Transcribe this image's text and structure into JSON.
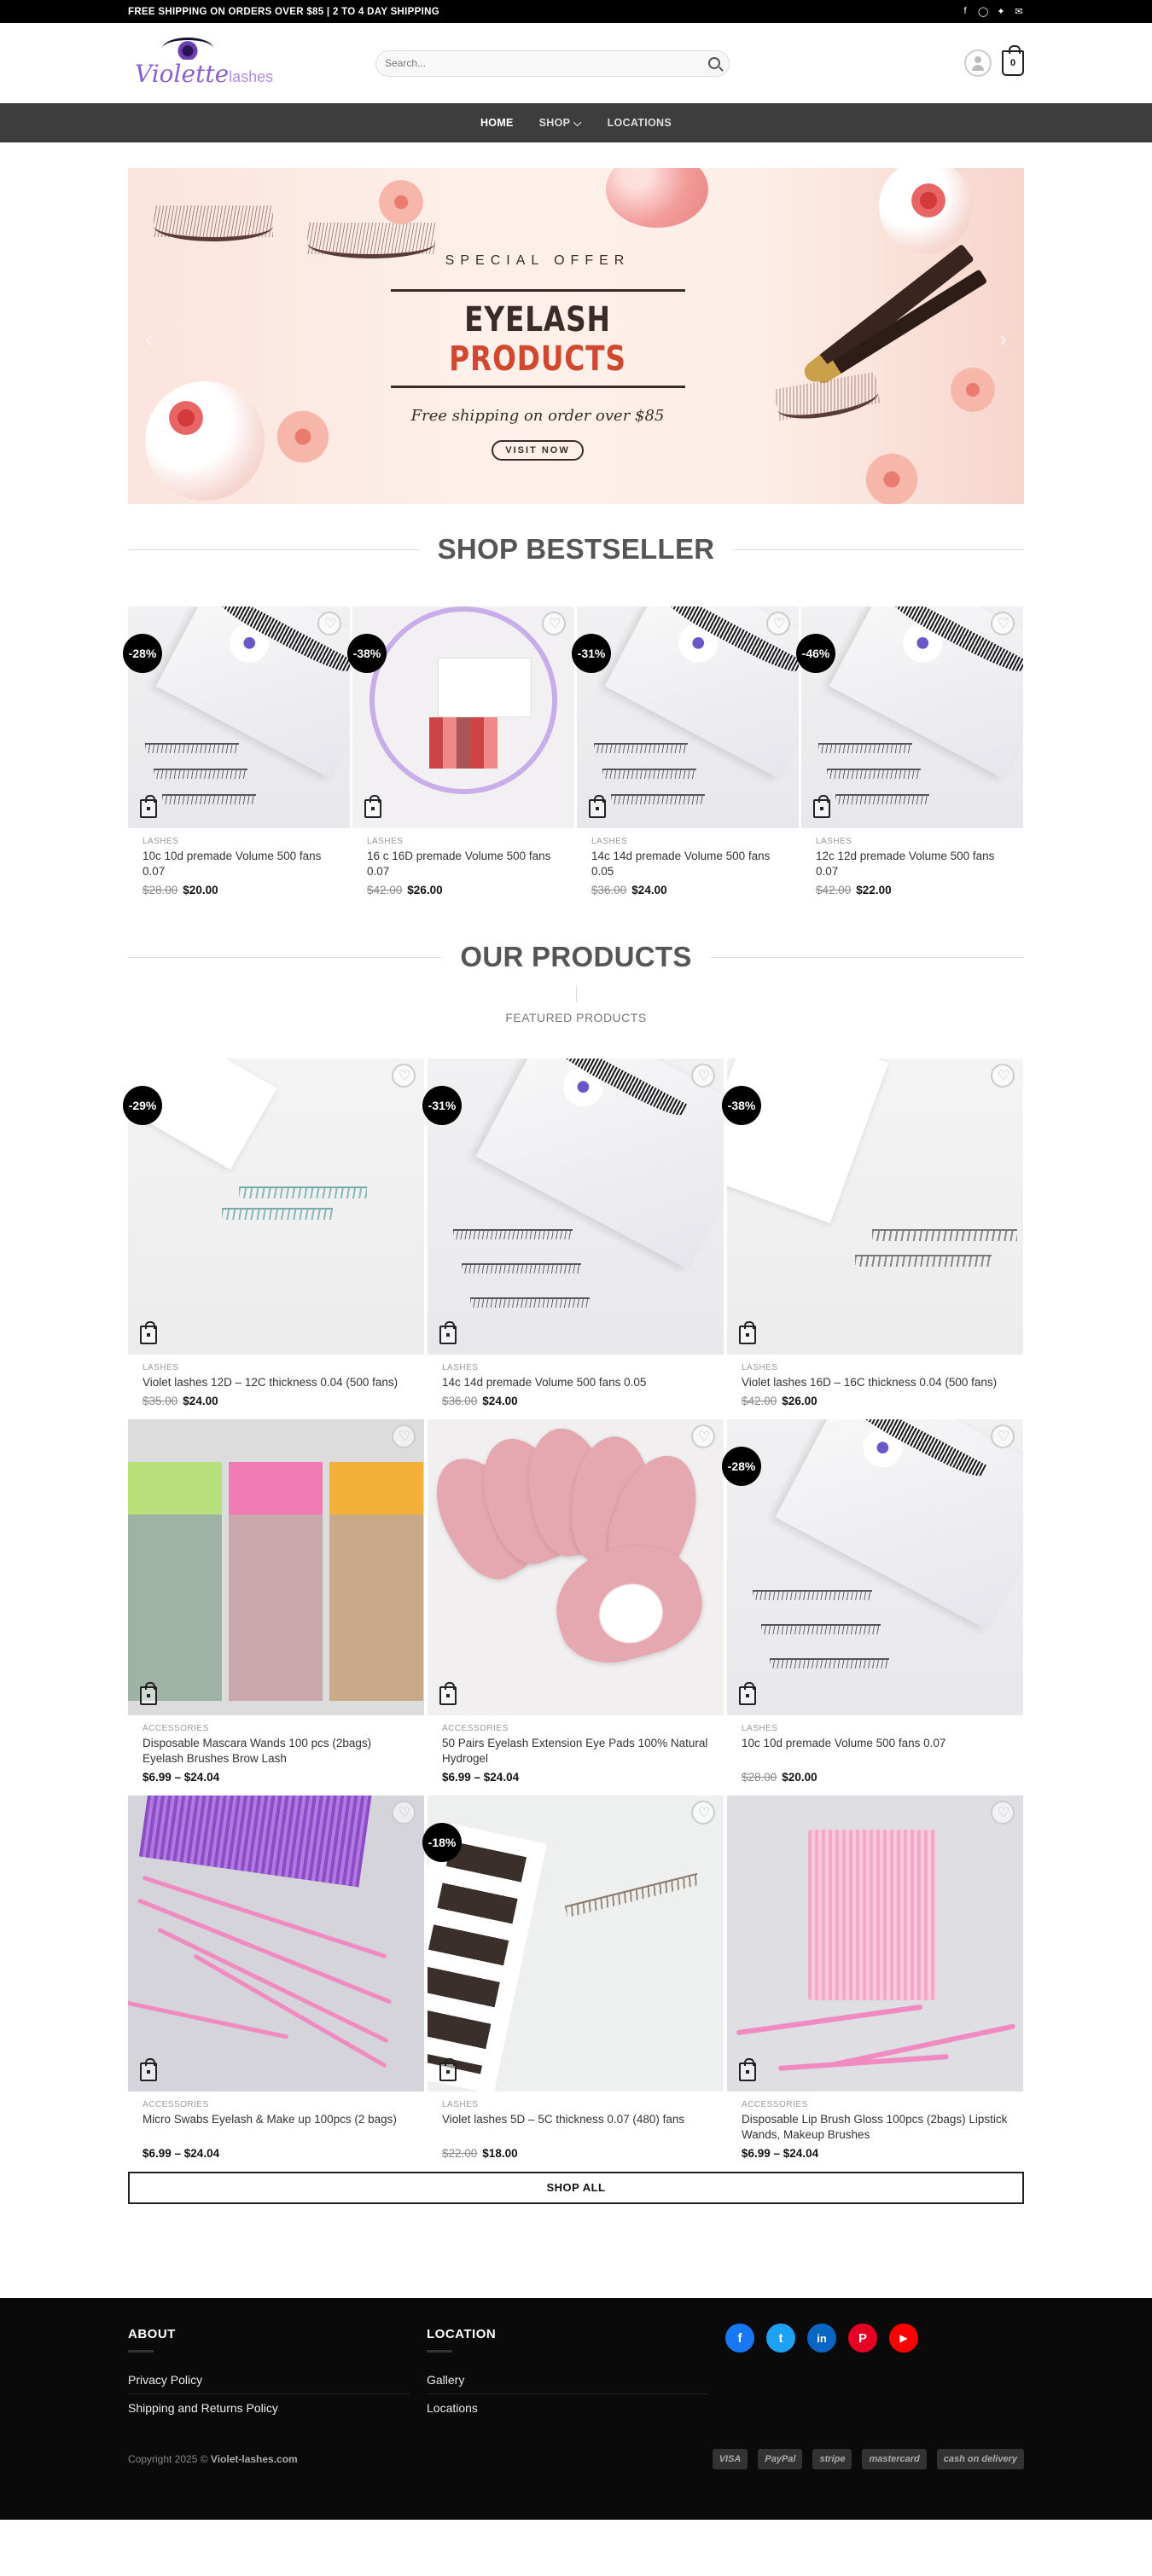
{
  "topbar": {
    "promo": "FREE SHIPPING ON ORDERS OVER $85 | 2 TO 4 DAY SHIPPING",
    "socials": [
      "facebook-icon",
      "instagram-icon",
      "twitter-icon",
      "email-icon"
    ]
  },
  "header": {
    "logo_text": "Violette",
    "logo_suffix": "lashes",
    "search_placeholder": "Search...",
    "cart_count": "0"
  },
  "nav": {
    "items": [
      {
        "label": "HOME",
        "active": true
      },
      {
        "label": "SHOP ⌵",
        "active": false
      },
      {
        "label": "LOCATIONS",
        "active": false
      }
    ]
  },
  "hero": {
    "special": "SPECIAL OFFER",
    "title_a": "EYELASH",
    "title_b": "PRODUCTS",
    "subtitle": "Free shipping on order over $85",
    "button": "VISIT NOW"
  },
  "bestseller": {
    "title": "SHOP BESTSELLER",
    "products": [
      {
        "badge": "-28%",
        "cat": "LASHES",
        "name": "10c 10d premade Volume 500 fans 0.07",
        "old": "$28.00",
        "new": "$20.00"
      },
      {
        "badge": "-38%",
        "cat": "LASHES",
        "name": "16 c 16D premade Volume 500 fans 0.07",
        "old": "$42.00",
        "new": "$26.00"
      },
      {
        "badge": "-31%",
        "cat": "LASHES",
        "name": "14c 14d premade Volume 500 fans 0.05",
        "old": "$36.00",
        "new": "$24.00"
      },
      {
        "badge": "-46%",
        "cat": "LASHES",
        "name": "12c 12d premade Volume 500 fans 0.07",
        "old": "$42.00",
        "new": "$22.00"
      }
    ]
  },
  "products": {
    "title": "OUR PRODUCTS",
    "subtitle": "FEATURED PRODUCTS",
    "items": [
      {
        "badge": "-29%",
        "cat": "LASHES",
        "name": "Violet lashes 12D – 12C thickness 0.04 (500 fans)",
        "old": "$35.00",
        "new": "$24.00"
      },
      {
        "badge": "-31%",
        "cat": "LASHES",
        "name": "14c 14d premade Volume 500 fans 0.05",
        "old": "$36.00",
        "new": "$24.00"
      },
      {
        "badge": "-38%",
        "cat": "LASHES",
        "name": "Violet lashes 16D – 16C thickness 0.04 (500 fans)",
        "old": "$42.00",
        "new": "$26.00"
      },
      {
        "badge": "",
        "cat": "ACCESSORIES",
        "name": "Disposable Mascara Wands 100 pcs (2bags) Eyelash Brushes Brow Lash",
        "range": "$6.99 – $24.04"
      },
      {
        "badge": "",
        "cat": "ACCESSORIES",
        "name": "50 Pairs Eyelash Extension Eye Pads 100% Natural Hydrogel",
        "range": "$6.99 – $24.04"
      },
      {
        "badge": "-28%",
        "cat": "LASHES",
        "name": "10c 10d premade Volume 500 fans 0.07",
        "old": "$28.00",
        "new": "$20.00"
      },
      {
        "badge": "",
        "cat": "ACCESSORIES",
        "name": "Micro Swabs Eyelash & Make up 100pcs (2 bags)",
        "range": "$6.99 – $24.04"
      },
      {
        "badge": "-18%",
        "cat": "LASHES",
        "name": "Violet lashes 5D – 5C thickness 0.07 (480) fans",
        "old": "$22.00",
        "new": "$18.00"
      },
      {
        "badge": "",
        "cat": "ACCESSORIES",
        "name": "Disposable Lip Brush Gloss 100pcs (2bags) Lipstick Wands, Makeup Brushes",
        "range": "$6.99 – $24.04"
      }
    ],
    "shop_all": "SHOP ALL"
  },
  "footer": {
    "about_title": "ABOUT",
    "about_links": [
      "Privacy Policy",
      "Shipping and Returns Policy"
    ],
    "location_title": "LOCATION",
    "location_links": [
      "Gallery",
      "Locations"
    ],
    "social": [
      {
        "icon": "facebook-icon",
        "glyph": "f",
        "color": "#1877f2"
      },
      {
        "icon": "twitter-icon",
        "glyph": "t",
        "color": "#1da1f2"
      },
      {
        "icon": "linkedin-icon",
        "glyph": "in",
        "color": "#0a66c2"
      },
      {
        "icon": "pinterest-icon",
        "glyph": "P",
        "color": "#e60023"
      },
      {
        "icon": "youtube-icon",
        "glyph": "▶",
        "color": "#ff0000"
      }
    ],
    "copyright": "Copyright 2025 ©",
    "site": "Violet-lashes.com",
    "payments": [
      "VISA",
      "PayPal",
      "stripe",
      "mastercard",
      "cash on delivery"
    ]
  },
  "colors": {
    "accent": "#8a5fd0",
    "nav_bg": "#3d3d3d",
    "footer_bg": "#0a0a0a",
    "badge_bg": "#000000"
  }
}
